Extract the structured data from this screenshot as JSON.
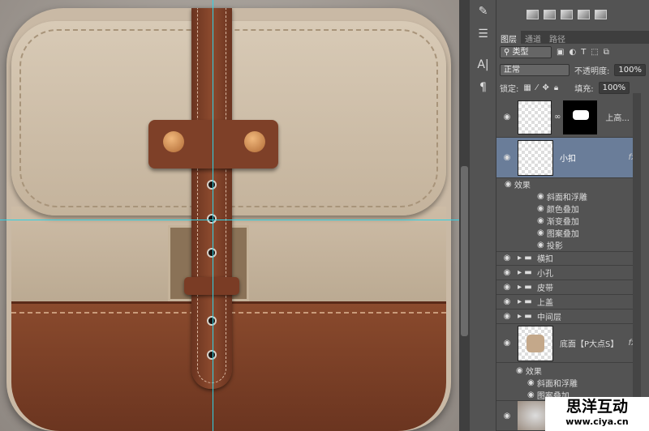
{
  "panel": {
    "tabs": [
      "图层",
      "通道",
      "路径"
    ],
    "filter": "类型",
    "blend_mode": "正常",
    "opacity_label": "不透明度:",
    "opacity": "100%",
    "lock_label": "锁定:",
    "fill_label": "填充:",
    "fill": "100%"
  },
  "layers": [
    {
      "name": "上高...",
      "type": "masked"
    },
    {
      "name": "小扣",
      "selected": true,
      "fx": "fx",
      "effects_label": "效果",
      "effects": [
        "斜面和浮雕",
        "颜色叠加",
        "渐变叠加",
        "图案叠加",
        "投影"
      ]
    },
    {
      "name": "横扣",
      "type": "group"
    },
    {
      "name": "小孔",
      "type": "group"
    },
    {
      "name": "皮带",
      "type": "group"
    },
    {
      "name": "上盖",
      "type": "group"
    },
    {
      "name": "中间层",
      "type": "group"
    },
    {
      "name": "底面【P大点S】",
      "fx": "fx",
      "effects_label": "效果",
      "effects": [
        "斜面和浮雕",
        "图案叠加"
      ]
    }
  ],
  "tools": [
    "A|",
    "¶"
  ],
  "watermark": {
    "title": "思洋互动",
    "url": "www.ciya.cn"
  },
  "colors": {
    "guide": "#2fd3e6",
    "selected_layer": "#6a7d99",
    "leather": "#7e4028",
    "canvas_fabric": "#c9b9a5"
  }
}
